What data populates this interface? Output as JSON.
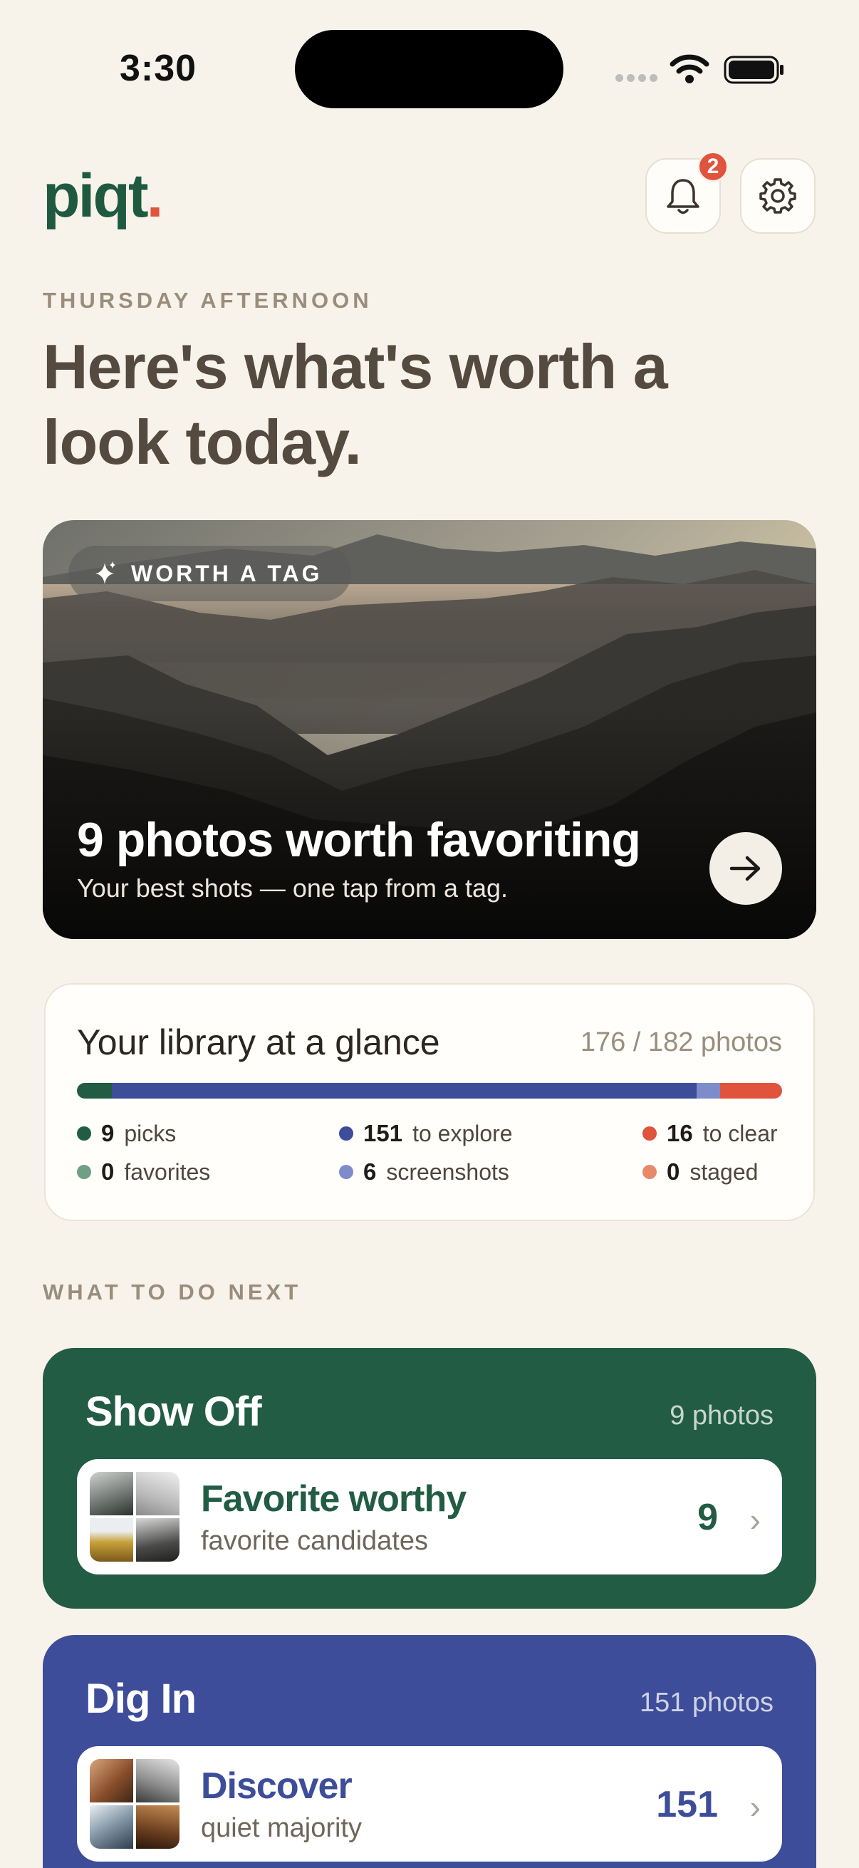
{
  "status_bar": {
    "time": "3:30"
  },
  "header": {
    "logo_text": "piqt",
    "logo_dot": ".",
    "notification_count": "2"
  },
  "greeting": {
    "eyebrow": "THURSDAY AFTERNOON",
    "headline": "Here's what's worth a look today."
  },
  "hero": {
    "pill_label": "WORTH A TAG",
    "title": "9 photos worth favoriting",
    "subtitle": "Your best shots — one tap from a tag."
  },
  "library": {
    "title": "Your library at a glance",
    "count": "176 / 182 photos",
    "bar_segments": [
      {
        "name": "picks",
        "value": 9,
        "color": "#225c44"
      },
      {
        "name": "to explore",
        "value": 151,
        "color": "#3d4d99"
      },
      {
        "name": "screenshots",
        "value": 6,
        "color": "#7f8ccc"
      },
      {
        "name": "to clear",
        "value": 16,
        "color": "#e0533c"
      }
    ],
    "stats": [
      {
        "value": "9",
        "label": "picks",
        "color": "#225c44"
      },
      {
        "value": "0",
        "label": "favorites",
        "color": "#6f9f86"
      },
      {
        "value": "151",
        "label": "to explore",
        "color": "#3d4d99"
      },
      {
        "value": "6",
        "label": "screenshots",
        "color": "#7f8ccc"
      },
      {
        "value": "16",
        "label": "to clear",
        "color": "#e0533c"
      },
      {
        "value": "0",
        "label": "staged",
        "color": "#e88a67"
      }
    ]
  },
  "next": {
    "eyebrow": "WHAT TO DO NEXT",
    "cards": [
      {
        "title": "Show Off",
        "count": "9 photos",
        "row_title": "Favorite worthy",
        "row_subtitle": "favorite candidates",
        "row_count": "9",
        "accent": "#225c44"
      },
      {
        "title": "Dig In",
        "count": "151 photos",
        "row_title": "Discover",
        "row_subtitle": "quiet majority",
        "row_count": "151",
        "accent": "#3d4d99"
      }
    ]
  },
  "icons": [
    "bell-icon",
    "gear-icon",
    "sparkle-icon",
    "arrow-right-icon",
    "chevron-right-icon",
    "wifi-icon",
    "battery-icon"
  ]
}
